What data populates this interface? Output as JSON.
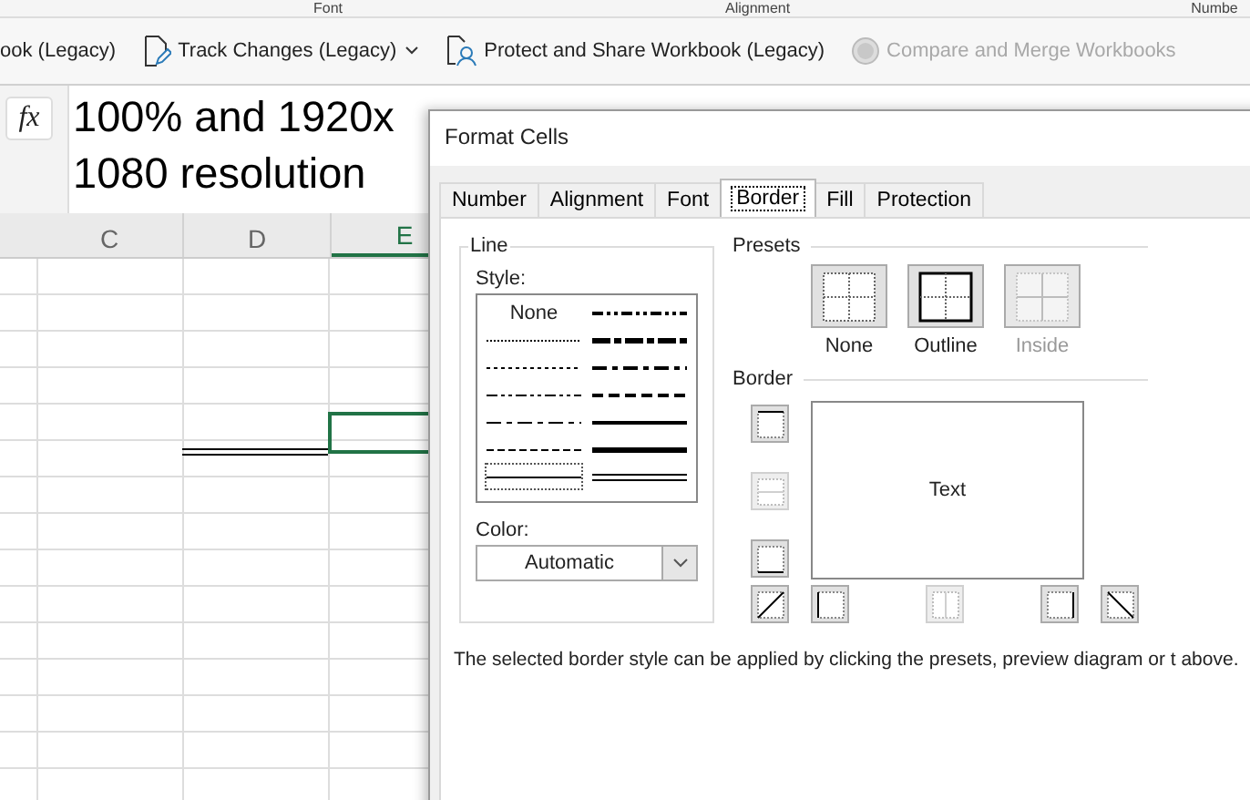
{
  "ribbon": {
    "group_labels": [
      "Font",
      "Alignment",
      "Numbe"
    ],
    "commands": [
      {
        "label": "ook (Legacy)",
        "kind": "plain",
        "disabled": false
      },
      {
        "label": "Track Changes (Legacy)",
        "kind": "track",
        "disabled": false,
        "dropdown": true
      },
      {
        "label": "Protect and Share Workbook (Legacy)",
        "kind": "protect",
        "disabled": false
      },
      {
        "label": "Compare and Merge Workbooks",
        "kind": "compare",
        "disabled": true
      }
    ]
  },
  "formula_bar": {
    "function_label": "fx"
  },
  "sheet": {
    "columns": [
      {
        "label": "C",
        "selected": false
      },
      {
        "label": "D",
        "selected": false
      },
      {
        "label": "E",
        "selected": true
      }
    ]
  },
  "annotation": "100% and 1920x 1080 resolution",
  "dialog": {
    "title": "Format Cells",
    "tabs": [
      {
        "label": "Number",
        "selected": false
      },
      {
        "label": "Alignment",
        "selected": false
      },
      {
        "label": "Font",
        "selected": false
      },
      {
        "label": "Border",
        "selected": true
      },
      {
        "label": "Fill",
        "selected": false
      },
      {
        "label": "Protection",
        "selected": false
      }
    ],
    "line_group": "Line",
    "style_label": "Style:",
    "line_styles": [
      {
        "kind": "none",
        "label": "None",
        "selected": false
      },
      {
        "kind": "hair",
        "selected": false
      },
      {
        "kind": "dotted",
        "selected": false
      },
      {
        "kind": "dashdotdot",
        "selected": false
      },
      {
        "kind": "dashdot",
        "selected": false
      },
      {
        "kind": "dashed",
        "selected": false
      },
      {
        "kind": "thin",
        "selected": true
      },
      {
        "kind": "mdashdotdot",
        "selected": false
      },
      {
        "kind": "slant",
        "selected": false
      },
      {
        "kind": "mdashdot",
        "selected": false
      },
      {
        "kind": "mdashed",
        "selected": false
      },
      {
        "kind": "medium",
        "selected": false
      },
      {
        "kind": "thick",
        "selected": false
      },
      {
        "kind": "double",
        "selected": false
      }
    ],
    "color_label": "Color:",
    "color_value": "Automatic",
    "presets_label": "Presets",
    "presets": [
      {
        "kind": "none",
        "label": "None",
        "disabled": false
      },
      {
        "kind": "outline",
        "label": "Outline",
        "disabled": false
      },
      {
        "kind": "inside",
        "label": "Inside",
        "disabled": true
      }
    ],
    "border_label": "Border",
    "preview_text": "Text",
    "side_buttons": [
      {
        "kind": "top",
        "disabled": false
      },
      {
        "kind": "hmiddle",
        "disabled": true
      },
      {
        "kind": "bottom",
        "disabled": false
      }
    ],
    "bottom_buttons": [
      {
        "kind": "diagup",
        "disabled": false
      },
      {
        "kind": "left",
        "disabled": false
      },
      {
        "kind": "vmiddle",
        "disabled": true
      },
      {
        "kind": "right",
        "disabled": false
      },
      {
        "kind": "diagdown",
        "disabled": false
      }
    ],
    "description": "The selected border style can be applied by clicking the presets, preview diagram or t above."
  }
}
